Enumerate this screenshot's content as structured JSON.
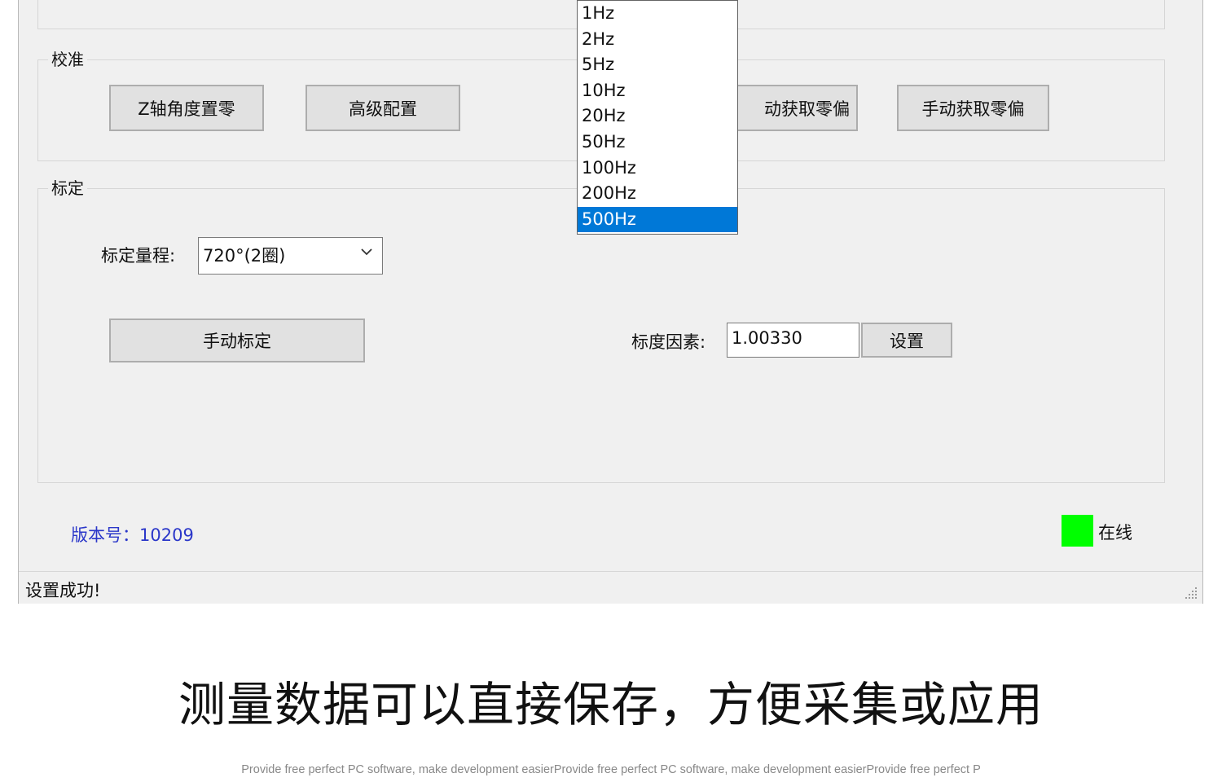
{
  "calibration_zero": {
    "title": "校准",
    "buttons": {
      "z_axis_zero": "Z轴角度置零",
      "advanced_config": "高级配置",
      "auto_zero_bias": "动获取零偏",
      "manual_zero_bias": "手动获取零偏"
    }
  },
  "calibration_scale": {
    "title": "标定",
    "range_label": "标定量程:",
    "range_value": "720°(2圈)",
    "manual_calibrate": "手动标定",
    "scale_factor_label": "标度因素:",
    "scale_factor_value": "1.00330",
    "set_button": "设置"
  },
  "version": "版本号：10209",
  "online_status": "在线",
  "status_message": "设置成功!",
  "rate_dropdown": {
    "options": [
      "1Hz",
      "2Hz",
      "5Hz",
      "10Hz",
      "20Hz",
      "50Hz",
      "100Hz",
      "200Hz",
      "500Hz"
    ],
    "selected": "500Hz"
  },
  "caption": "测量数据可以直接保存，方便采集或应用",
  "footer": "Provide free perfect PC software, make development easierProvide free perfect PC software, make development easierProvide free perfect P",
  "colors": {
    "online_indicator": "#00ff00",
    "version_text": "#2b37c9",
    "dropdown_selection": "#0078d7"
  }
}
